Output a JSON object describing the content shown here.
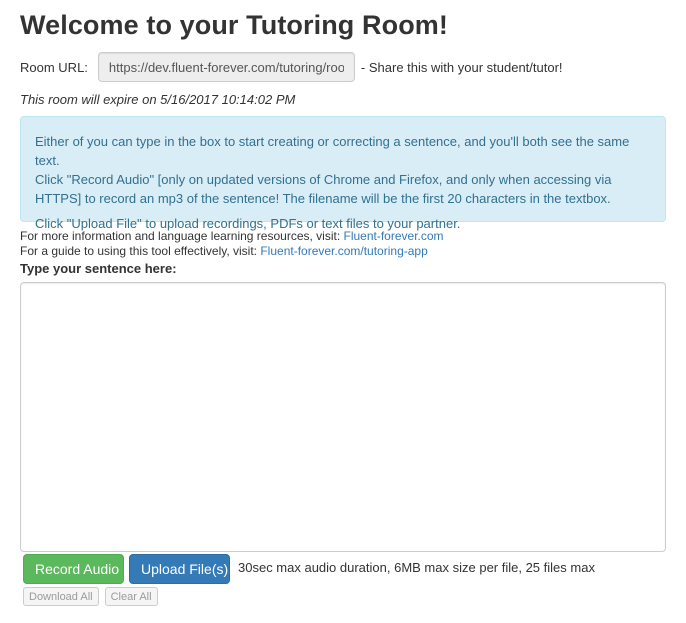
{
  "page": {
    "title": "Welcome to your Tutoring Room!"
  },
  "room_url": {
    "label": "Room URL:",
    "value": "https://dev.fluent-forever.com/tutoring/roo",
    "share_text": "- Share this with your student/tutor!"
  },
  "expiry": {
    "text": "This room will expire on 5/16/2017 10:14:02 PM"
  },
  "info_box": {
    "line1": "Either of you can type in the box to start creating or correcting a sentence, and you'll both see the same text.",
    "line2": "Click \"Record Audio\" [only on updated versions of Chrome and Firefox, and only when accessing via HTTPS] to record an mp3 of the sentence! The filename will be the first 20 characters in the textbox.",
    "line3": "Click \"Upload File\" to upload recordings, PDFs or text files to your partner."
  },
  "links": {
    "info_prefix": "For more information and language learning resources, visit: ",
    "info_link": "Fluent-forever.com",
    "guide_prefix": "For a guide to using this tool effectively, visit: ",
    "guide_link": "Fluent-forever.com/tutoring-app"
  },
  "sentence": {
    "label": "Type your sentence here:",
    "value": ""
  },
  "actions": {
    "record_label": "Record Audio",
    "upload_label": "Upload File(s)",
    "limits_text": "30sec max audio duration, 6MB max size per file, 25 files max",
    "download_all_label": "Download All",
    "clear_all_label": "Clear All"
  },
  "colors": {
    "success": "#5cb85c",
    "primary": "#337ab7",
    "info_bg": "#d9edf7",
    "info_text": "#31708f",
    "link": "#337ab7"
  }
}
